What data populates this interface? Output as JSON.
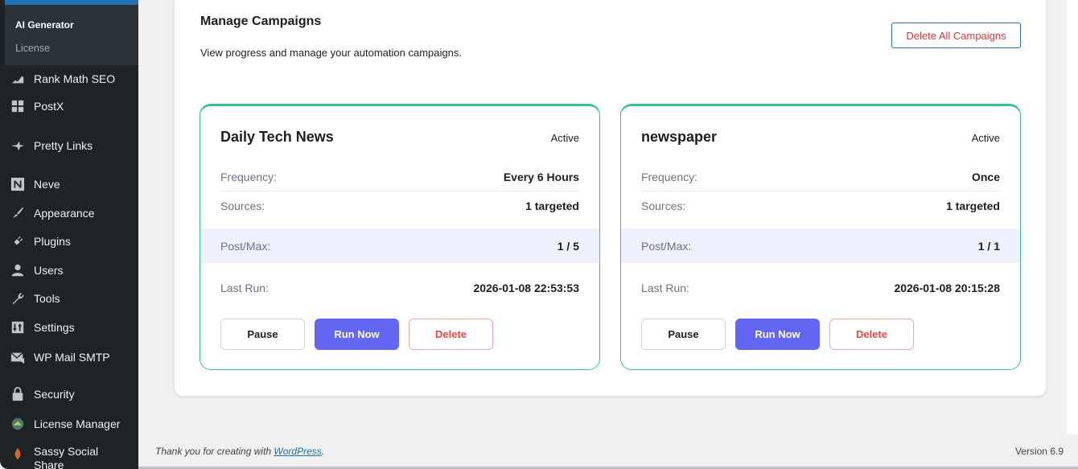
{
  "sidebar": {
    "submenu": {
      "active": "AI Generator",
      "item": "License"
    },
    "items": [
      {
        "label": "Rank Math SEO",
        "icon": "chart-icon"
      },
      {
        "label": "PostX",
        "icon": "grid-icon"
      },
      {
        "label": "Pretty Links",
        "icon": "star-icon"
      },
      {
        "label": "Neve",
        "icon": "neve-icon"
      },
      {
        "label": "Appearance",
        "icon": "brush-icon"
      },
      {
        "label": "Plugins",
        "icon": "plug-icon"
      },
      {
        "label": "Users",
        "icon": "user-icon"
      },
      {
        "label": "Tools",
        "icon": "wrench-icon"
      },
      {
        "label": "Settings",
        "icon": "sliders-icon"
      },
      {
        "label": "WP Mail SMTP",
        "icon": "mail-icon"
      },
      {
        "label": "Security",
        "icon": "lock-icon"
      },
      {
        "label": "License Manager",
        "icon": "key-icon"
      },
      {
        "label": "Sassy Social Share",
        "icon": "share-icon"
      }
    ]
  },
  "panel": {
    "title": "Manage Campaigns",
    "subtitle": "View progress and manage your automation campaigns.",
    "delete_all_label": "Delete All Campaigns"
  },
  "labels": {
    "frequency": "Frequency:",
    "sources": "Sources:",
    "postmax": "Post/Max:",
    "lastrun": "Last Run:",
    "pause": "Pause",
    "run_now": "Run Now",
    "delete": "Delete"
  },
  "campaigns": [
    {
      "name": "Daily Tech News",
      "status": "Active",
      "frequency": "Every 6 Hours",
      "sources": "1 targeted",
      "postmax": "1 / 5",
      "last_run": "2026-01-08 22:53:53"
    },
    {
      "name": "newspaper",
      "status": "Active",
      "frequency": "Once",
      "sources": "1 targeted",
      "postmax": "1 / 1",
      "last_run": "2026-01-08 20:15:28"
    }
  ],
  "footer": {
    "thanks_prefix": "Thank you for creating with ",
    "thanks_link": "WordPress",
    "thanks_suffix": ".",
    "version": "Version 6.9"
  },
  "colors": {
    "sidebar_bg": "#1d2327",
    "accent": "#6366f1",
    "card_border": "#34c38f",
    "danger": "#ef4444"
  }
}
